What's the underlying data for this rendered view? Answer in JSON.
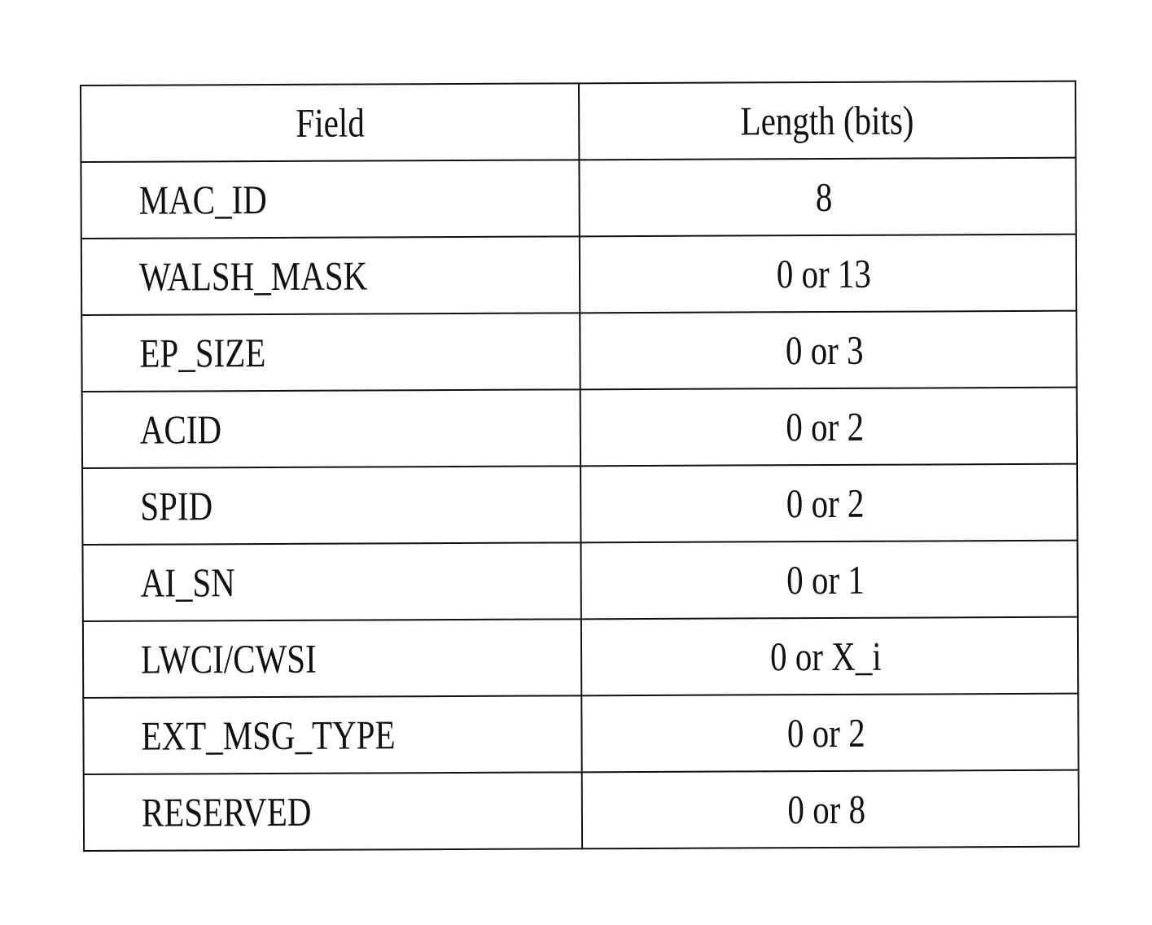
{
  "table": {
    "headers": {
      "field": "Field",
      "length": "Length (bits)"
    },
    "rows": [
      {
        "field": "MAC_ID",
        "length": "8"
      },
      {
        "field": "WALSH_MASK",
        "length": "0 or 13"
      },
      {
        "field": "EP_SIZE",
        "length": "0 or 3"
      },
      {
        "field": "ACID",
        "length": "0 or 2"
      },
      {
        "field": "SPID",
        "length": "0 or 2"
      },
      {
        "field": "AI_SN",
        "length": "0 or 1"
      },
      {
        "field": "LWCI/CWSI",
        "length": "0 or X_i"
      },
      {
        "field": "EXT_MSG_TYPE",
        "length": "0 or 2"
      },
      {
        "field": "RESERVED",
        "length": "0 or 8"
      }
    ]
  }
}
